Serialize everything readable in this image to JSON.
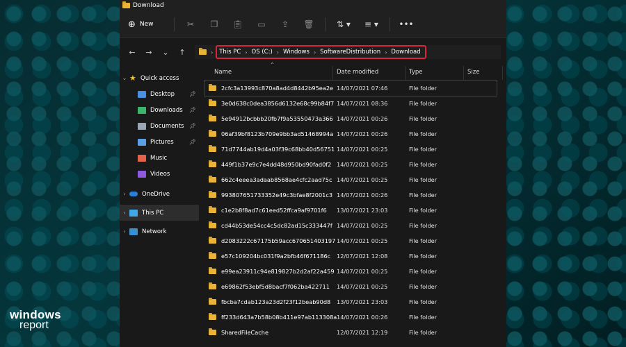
{
  "window": {
    "title": "Download"
  },
  "toolbar": {
    "new_label": "New"
  },
  "address": {
    "crumbs": [
      "This PC",
      "OS (C:)",
      "Windows",
      "SoftwareDistribution",
      "Download"
    ]
  },
  "sidebar": {
    "quick_access": "Quick access",
    "items": [
      {
        "label": "Desktop",
        "icon": "desktop-icon",
        "color": "#4a90e2",
        "pinned": true
      },
      {
        "label": "Downloads",
        "icon": "download-icon",
        "color": "#3ab56b",
        "pinned": true
      },
      {
        "label": "Documents",
        "icon": "documents-icon",
        "color": "#9aa6b3",
        "pinned": true
      },
      {
        "label": "Pictures",
        "icon": "pictures-icon",
        "color": "#5aa0e6",
        "pinned": true
      },
      {
        "label": "Music",
        "icon": "music-icon",
        "color": "#e2634a",
        "pinned": false
      },
      {
        "label": "Videos",
        "icon": "videos-icon",
        "color": "#8d5ae0",
        "pinned": false
      }
    ],
    "onedrive": "OneDrive",
    "this_pc": "This PC",
    "network": "Network"
  },
  "columns": {
    "name": "Name",
    "date": "Date modified",
    "type": "Type",
    "size": "Size"
  },
  "files": [
    {
      "name": "2cfc3a13993c870a8ad4d8442b95ea2e",
      "date": "14/07/2021 07:46",
      "type": "File folder"
    },
    {
      "name": "3e0d638c0dea3856d6132e68c99b84f7",
      "date": "14/07/2021 08:36",
      "type": "File folder"
    },
    {
      "name": "5e94912bcbbb20fb7f9a53550473a366",
      "date": "14/07/2021 00:26",
      "type": "File folder"
    },
    {
      "name": "06af39bf8123b709e9bb3ad51468994a",
      "date": "14/07/2021 00:26",
      "type": "File folder"
    },
    {
      "name": "71d7744ab19d4a03f39c68bb40d56751",
      "date": "14/07/2021 00:25",
      "type": "File folder"
    },
    {
      "name": "449f1b37e9c7e4dd48d950bd90fad0f2",
      "date": "14/07/2021 00:25",
      "type": "File folder"
    },
    {
      "name": "662c4eeea3adaab8568ae4cfc2aad75c",
      "date": "14/07/2021 00:25",
      "type": "File folder"
    },
    {
      "name": "993807651733352e49c3bfae8f2001c3",
      "date": "14/07/2021 00:26",
      "type": "File folder"
    },
    {
      "name": "c1e2b8f8ad7c61eed52ffca9af9701f6",
      "date": "13/07/2021 23:03",
      "type": "File folder"
    },
    {
      "name": "cd44b53de54cc4c5dc82ad15c333447f",
      "date": "14/07/2021 00:25",
      "type": "File folder"
    },
    {
      "name": "d2083222c67175b59acc670651403197",
      "date": "14/07/2021 00:25",
      "type": "File folder"
    },
    {
      "name": "e57c109204bc031f9a2bfb46f671186c",
      "date": "12/07/2021 12:08",
      "type": "File folder"
    },
    {
      "name": "e99ea23911c94e819827b2d2af22a459",
      "date": "14/07/2021 00:25",
      "type": "File folder"
    },
    {
      "name": "e69862f53ebf5d8bacf7f062ba422711",
      "date": "14/07/2021 00:25",
      "type": "File folder"
    },
    {
      "name": "fbcba7cdab123a23d2f23f12beab90d8",
      "date": "13/07/2021 23:03",
      "type": "File folder"
    },
    {
      "name": "ff233d643a7b58b08b411e97ab113308a",
      "date": "14/07/2021 00:26",
      "type": "File folder"
    },
    {
      "name": "SharedFileCache",
      "date": "12/07/2021 12:19",
      "type": "File folder"
    }
  ],
  "watermark": {
    "line1": "windows",
    "line2": "report"
  }
}
